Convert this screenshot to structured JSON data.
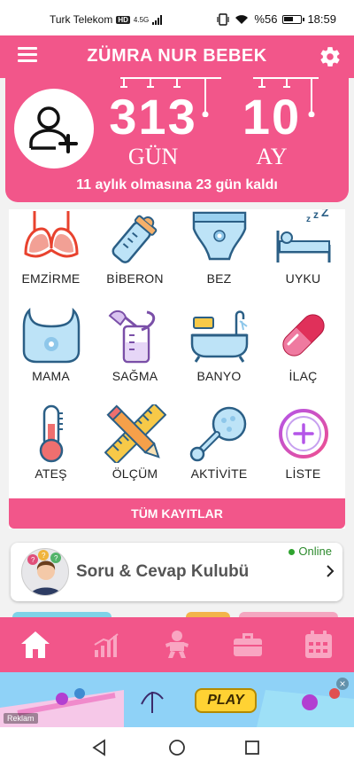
{
  "status": {
    "carrier": "Turk Telekom",
    "network": "4.5G",
    "hd": "HD",
    "battery": "%56",
    "time": "18:59"
  },
  "header": {
    "title": "ZÜMRA NUR  BEBEK"
  },
  "counter": {
    "days": "313",
    "days_unit": "GÜN",
    "months": "10",
    "months_unit": "AY",
    "countdown": "11 aylık olmasına 23 gün kaldı"
  },
  "activities": [
    {
      "label": "EMZİRME",
      "icon": "bra-icon"
    },
    {
      "label": "BİBERON",
      "icon": "baby-bottle-icon"
    },
    {
      "label": "BEZ",
      "icon": "diaper-icon"
    },
    {
      "label": "UYKU",
      "icon": "sleep-bed-icon"
    },
    {
      "label": "MAMA",
      "icon": "bib-icon"
    },
    {
      "label": "SAĞMA",
      "icon": "breast-pump-icon"
    },
    {
      "label": "BANYO",
      "icon": "bathtub-icon"
    },
    {
      "label": "İLAÇ",
      "icon": "pill-icon"
    },
    {
      "label": "ATEŞ",
      "icon": "thermometer-icon"
    },
    {
      "label": "ÖLÇÜM",
      "icon": "ruler-pencil-icon"
    },
    {
      "label": "AKTİVİTE",
      "icon": "rattle-icon"
    },
    {
      "label": "LİSTE",
      "icon": "add-circle-icon"
    }
  ],
  "all_records": "TÜM KAYITLAR",
  "club": {
    "title": "Soru & Cevap Kulubü",
    "status": "Online"
  },
  "bottom_nav": [
    {
      "name": "home",
      "icon": "home-icon"
    },
    {
      "name": "stats",
      "icon": "chart-icon"
    },
    {
      "name": "baby",
      "icon": "baby-icon"
    },
    {
      "name": "bag",
      "icon": "bag-icon"
    },
    {
      "name": "calendar",
      "icon": "calendar-icon"
    }
  ],
  "ad": {
    "tag": "Reklam",
    "play_label": "PLAY"
  },
  "colors": {
    "primary": "#f2568a",
    "online": "#2fa32f"
  }
}
